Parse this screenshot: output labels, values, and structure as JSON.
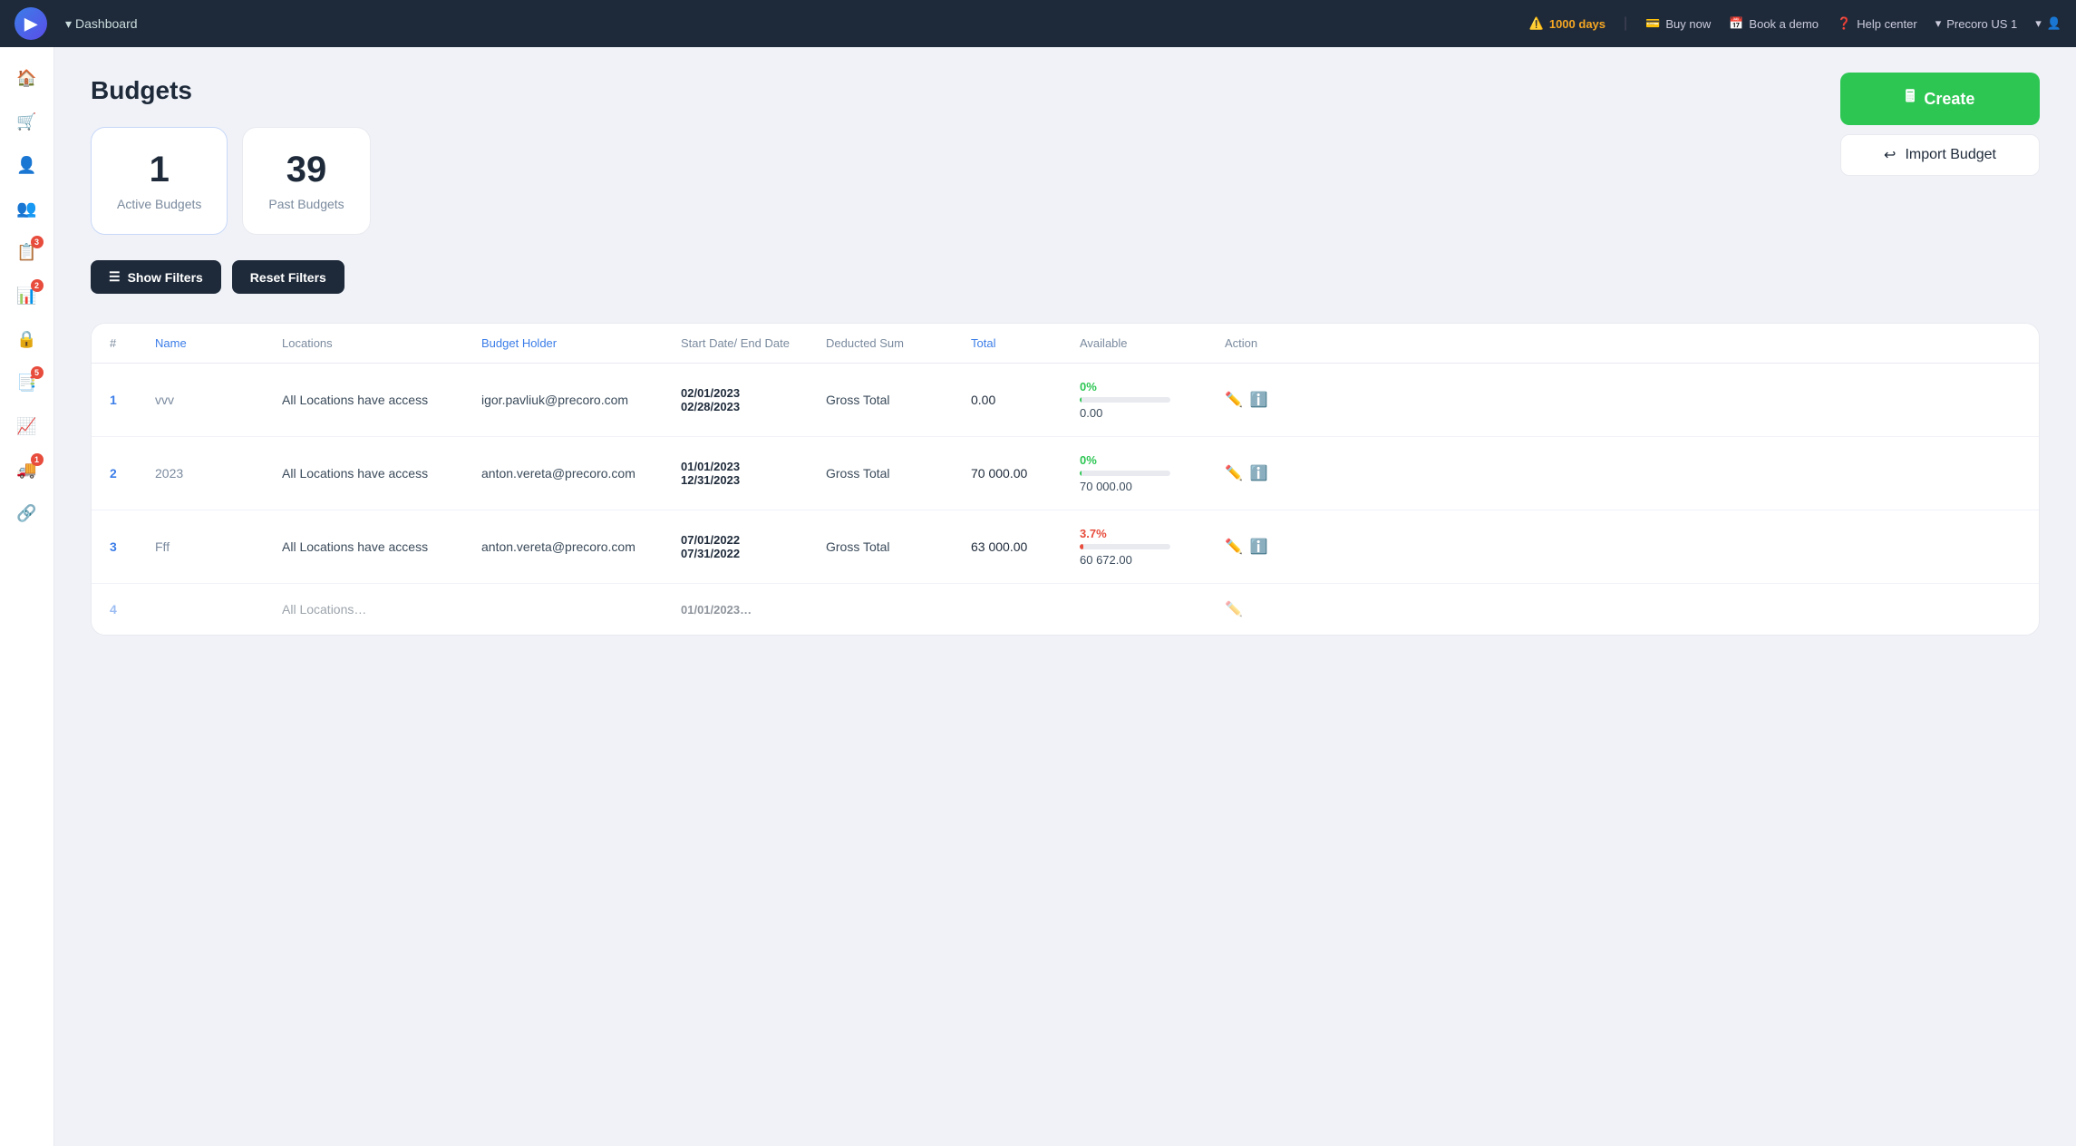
{
  "topnav": {
    "dashboard_label": "Dashboard",
    "warning_days": "1000 days",
    "buy_now": "Buy now",
    "book_demo": "Book a demo",
    "help_center": "Help center",
    "org_name": "Precoro US 1"
  },
  "sidebar": {
    "items": [
      {
        "name": "home",
        "icon": "🏠"
      },
      {
        "name": "orders",
        "icon": "🛒"
      },
      {
        "name": "users",
        "icon": "👤"
      },
      {
        "name": "team",
        "icon": "👥"
      },
      {
        "name": "requests",
        "icon": "📋",
        "badge": "3"
      },
      {
        "name": "analytics",
        "icon": "📊",
        "badge": "2"
      },
      {
        "name": "lock",
        "icon": "🔒"
      },
      {
        "name": "reports",
        "icon": "📑",
        "badge": "5"
      },
      {
        "name": "chart",
        "icon": "📈"
      },
      {
        "name": "delivery",
        "icon": "🚚",
        "badge": "1"
      },
      {
        "name": "integration",
        "icon": "🔗"
      }
    ]
  },
  "page": {
    "title": "Budgets"
  },
  "stats": {
    "active_count": "1",
    "active_label": "Active Budgets",
    "past_count": "39",
    "past_label": "Past Budgets"
  },
  "filters": {
    "show_label": "Show Filters",
    "reset_label": "Reset Filters"
  },
  "actions": {
    "create_label": "Create",
    "import_label": "Import Budget"
  },
  "table": {
    "headers": {
      "num": "#",
      "name": "Name",
      "locations": "Locations",
      "budget_holder": "Budget Holder",
      "start_end_date": "Start Date/ End Date",
      "deducted_sum": "Deducted Sum",
      "total": "Total",
      "available": "Available",
      "action": "Action"
    },
    "rows": [
      {
        "num": "1",
        "name": "vvv",
        "locations": "All Locations have access",
        "budget_holder": "igor.pavliuk@precoro.com",
        "start_date": "02/01/2023",
        "end_date": "02/28/2023",
        "deducted_sum": "Gross Total",
        "total": "0.00",
        "available": "0.00",
        "pct": "0%",
        "pct_class": "green",
        "bar_width": "2"
      },
      {
        "num": "2",
        "name": "2023",
        "locations": "All Locations have access",
        "budget_holder": "anton.vereta@precoro.com",
        "start_date": "01/01/2023",
        "end_date": "12/31/2023",
        "deducted_sum": "Gross Total",
        "total": "70 000.00",
        "available": "70 000.00",
        "pct": "0%",
        "pct_class": "green",
        "bar_width": "2"
      },
      {
        "num": "3",
        "name": "Fff",
        "locations": "All Locations have access",
        "budget_holder": "anton.vereta@precoro.com",
        "start_date": "07/01/2022",
        "end_date": "07/31/2022",
        "deducted_sum": "Gross Total",
        "total": "63 000.00",
        "available": "60 672.00",
        "pct": "3.7%",
        "pct_class": "red",
        "bar_width": "4"
      }
    ]
  }
}
